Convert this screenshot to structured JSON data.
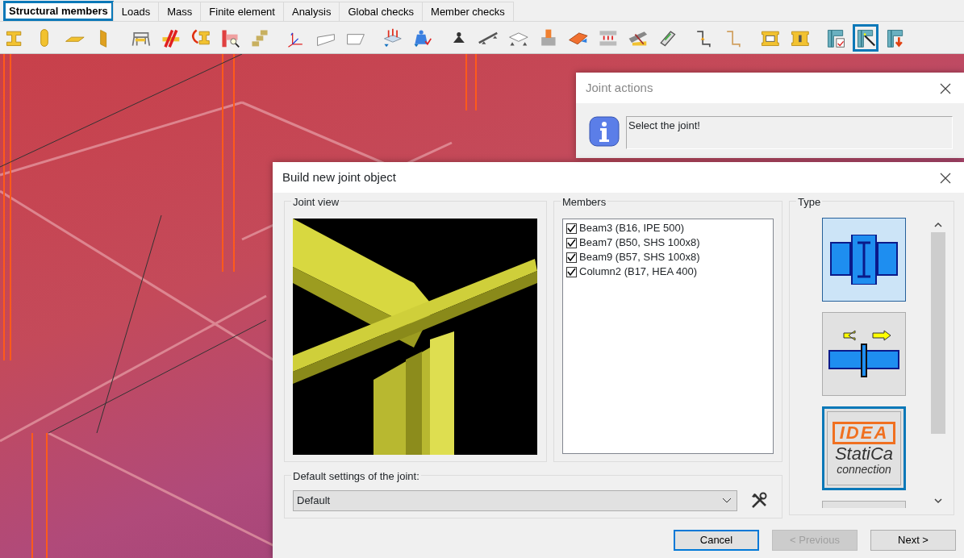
{
  "tabs": [
    {
      "label": "Structural members",
      "selected": true
    },
    {
      "label": "Loads",
      "selected": false
    },
    {
      "label": "Mass",
      "selected": false
    },
    {
      "label": "Finite element",
      "selected": false
    },
    {
      "label": "Analysis",
      "selected": false
    },
    {
      "label": "Global checks",
      "selected": false
    },
    {
      "label": "Member checks",
      "selected": false
    }
  ],
  "toolbar": [
    {
      "selected": false
    },
    {
      "selected": false
    },
    {
      "selected": false
    },
    {
      "selected": false
    },
    {
      "selected": false
    },
    {
      "selected": false
    },
    {
      "selected": false
    },
    {
      "selected": false
    },
    {
      "selected": false
    },
    {
      "selected": false
    },
    {
      "selected": false
    },
    {
      "selected": false
    },
    {
      "selected": false
    },
    {
      "selected": false
    },
    {
      "selected": false
    },
    {
      "selected": false
    },
    {
      "selected": false
    },
    {
      "selected": false
    },
    {
      "selected": false
    },
    {
      "selected": false
    },
    {
      "selected": false
    },
    {
      "selected": false
    },
    {
      "selected": false
    },
    {
      "selected": false
    },
    {
      "selected": false
    },
    {
      "selected": false
    },
    {
      "selected": false
    },
    {
      "selected": true
    },
    {
      "selected": false
    }
  ],
  "joint_actions": {
    "title": "Joint actions",
    "message": "Select the joint!"
  },
  "build_dialog": {
    "title": "Build new joint object",
    "joint_view": {
      "label": "Joint view"
    },
    "members": {
      "label": "Members",
      "items": [
        {
          "label": "Beam3 (B16, IPE 500)",
          "checked": true
        },
        {
          "label": "Beam7 (B50, SHS 100x8)",
          "checked": true
        },
        {
          "label": "Beam9 (B57, SHS 100x8)",
          "checked": true
        },
        {
          "label": "Column2 (B17, HEA 400)",
          "checked": true
        }
      ]
    },
    "type": {
      "label": "Type",
      "items": [
        {
          "kind": "beam-column",
          "selected": true,
          "focused": false
        },
        {
          "kind": "splice",
          "selected": false,
          "focused": false
        },
        {
          "kind": "logo",
          "selected": false,
          "focused": true,
          "logo": "IDEA",
          "name": "StatiCa",
          "subtitle": "connection"
        },
        {
          "kind": "blank",
          "selected": false,
          "focused": false
        }
      ]
    },
    "default_settings": {
      "label": "Default settings of the joint:",
      "value": "Default"
    },
    "buttons": [
      {
        "label": "Cancel",
        "disabled": false,
        "default": true
      },
      {
        "label": "< Previous",
        "disabled": true,
        "default": false
      },
      {
        "label": "Next >",
        "disabled": false,
        "default": false
      }
    ]
  }
}
